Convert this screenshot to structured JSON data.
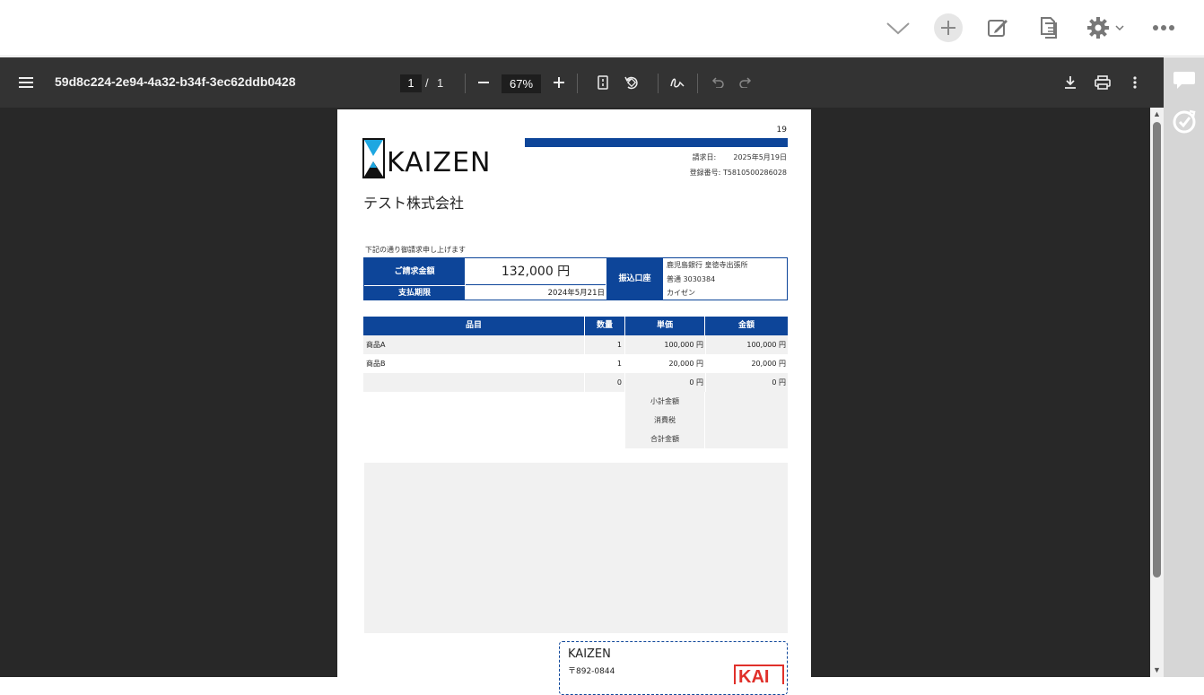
{
  "colors": {
    "accent": "#0d4599",
    "viewer_bg": "#282828",
    "toolbar_bg": "#333333",
    "row_shade": "#f1f1f1"
  },
  "topbar": {
    "icons": [
      "chevron-down-icon",
      "add-icon",
      "edit-icon",
      "document-copy-icon",
      "gear-icon",
      "more-icon"
    ]
  },
  "viewer": {
    "title": "59d8c224-2e94-4a32-b34f-3ec62ddb0428",
    "page_current": "1",
    "page_sep": "/",
    "page_total": "1",
    "zoom": "67%"
  },
  "invoice": {
    "page_number": "19",
    "logo_text": "KAIZEN",
    "date_label": "請求日:",
    "date_value": "2025年5月19日",
    "reg_label": "登録番号:",
    "reg_value": "T5810500286028",
    "company": "テスト株式会社",
    "intro": "下記の通り御請求申し上げます",
    "amount_label": "ご請求金額",
    "amount_value": "132,000 円",
    "due_label": "支払期限",
    "due_value": "2024年5月21日",
    "bank_label": "振込口座",
    "bank_lines": [
      "鹿児島銀行 皇徳寺出張所",
      "普通 3030384",
      "カイゼン"
    ],
    "item_headers": {
      "name": "品目",
      "qty": "数量",
      "unit": "単価",
      "amount": "金額"
    },
    "items": [
      {
        "name": "商品A",
        "qty": "1",
        "unit": "100,000 円",
        "amount": "100,000 円"
      },
      {
        "name": "商品B",
        "qty": "1",
        "unit": "20,000 円",
        "amount": "20,000 円"
      },
      {
        "name": "",
        "qty": "0",
        "unit": "0 円",
        "amount": "0 円"
      }
    ],
    "totals": {
      "subtotal": "小計金額",
      "tax": "消費税",
      "total": "合計金額"
    },
    "issuer_name": "KAIZEN",
    "issuer_zip": "〒892-0844",
    "seal_text": "KAI"
  }
}
